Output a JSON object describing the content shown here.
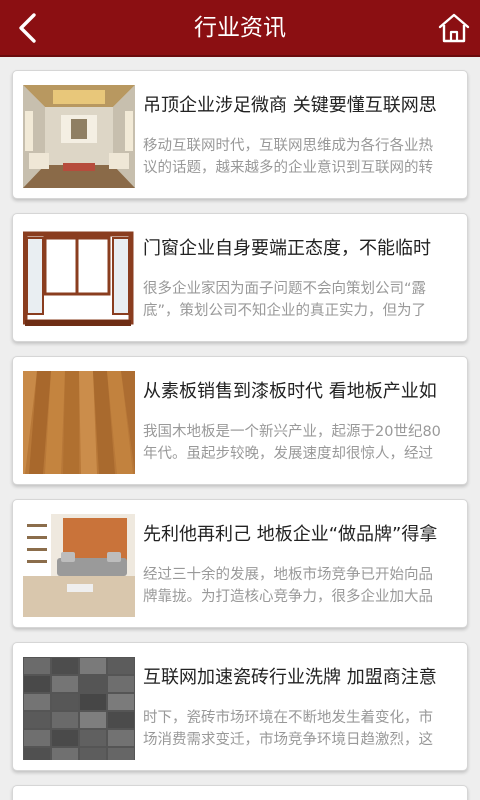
{
  "header": {
    "title": "行业资讯",
    "back_icon": "chevron-left-icon",
    "home_icon": "home-icon"
  },
  "colors": {
    "header_bg": "#8b0f12",
    "title_text": "#222222",
    "summary_text": "#999999"
  },
  "articles": [
    {
      "title": "吊顶企业涉足微商 关键要懂互联网思",
      "summary": "移动互联网时代，互联网思维成为各行各业热议的话题，越来越多的企业意识到互联网的转",
      "thumbnail": "living-room-ceiling"
    },
    {
      "title": "门窗企业自身要端正态度，不能临时",
      "summary": "很多企业家因为面子问题不会向策划公司“露底”，策划公司不知企业的真正实力，但为了",
      "thumbnail": "window-frame"
    },
    {
      "title": "从素板销售到漆板时代 看地板产业如",
      "summary": "我国木地板是一个新兴产业，起源于20世纪80年代。虽起步较晚，发展速度却很惊人，经过",
      "thumbnail": "wood-floor"
    },
    {
      "title": "先利他再利己 地板企业“做品牌”得拿",
      "summary": "经过三十余的发展，地板市场竞争已开始向品牌靠拢。为打造核心竞争力，很多企业加大品",
      "thumbnail": "living-room-floor"
    },
    {
      "title": "互联网加速瓷砖行业洗牌 加盟商注意",
      "summary": "时下，瓷砖市场环境在不断地发生着变化，市场消费需求变迁，市场竞争环境日趋激烈，这",
      "thumbnail": "gray-tiles"
    }
  ]
}
